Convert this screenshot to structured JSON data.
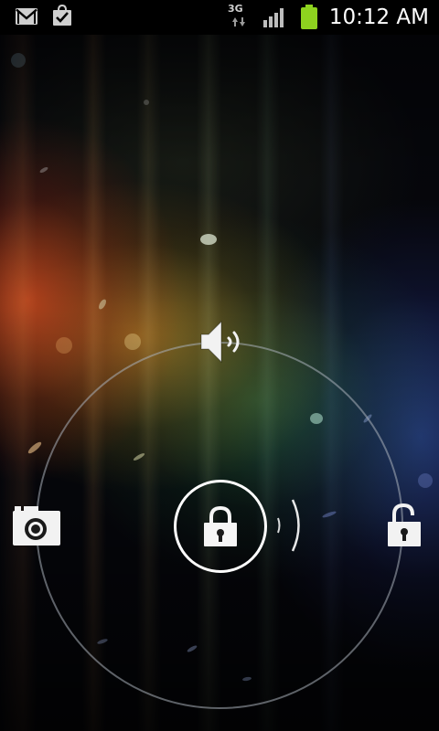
{
  "status_bar": {
    "time": "10:12 AM",
    "network_type": "3G",
    "icons": {
      "gmail": "gmail-icon",
      "market_update": "market-check-icon",
      "network": "3g-data-icon",
      "signal": "signal-icon",
      "battery": "battery-icon"
    },
    "battery_color": "#8ed31f"
  },
  "lockscreen": {
    "targets": {
      "top": "sound-icon",
      "left": "camera-icon",
      "right": "unlock-icon",
      "center": "lock-icon"
    },
    "ring_color": "#9aa0a8"
  }
}
